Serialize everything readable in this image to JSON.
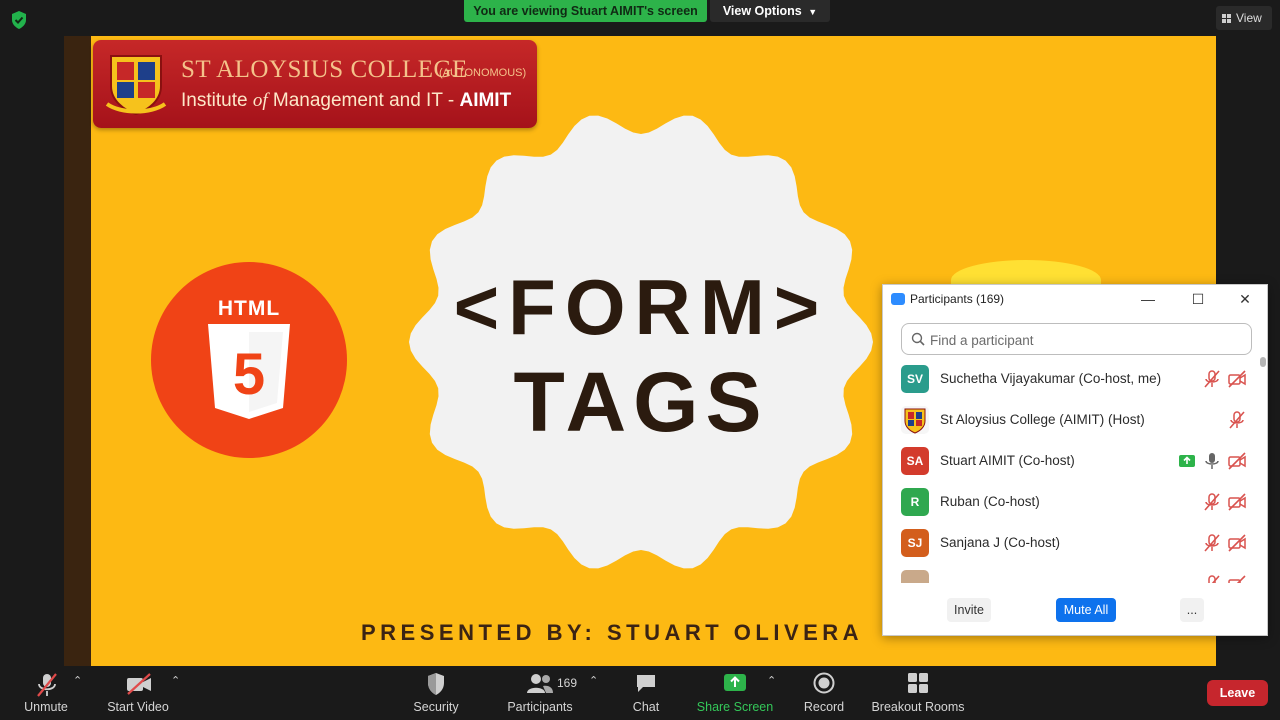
{
  "colors": {
    "accent_green": "#2db34a",
    "slide_bg": "#fdb913",
    "mute_all": "#0e72ed",
    "leave": "#c6262d"
  },
  "topbar": {
    "viewing_text": "You are viewing Stuart AIMIT's screen",
    "view_options": "View Options",
    "view_label": "View"
  },
  "slide": {
    "college_name": "ST ALOYSIUS COLLEGE",
    "college_autonomous": "(AUTONOMOUS)",
    "college_sub_prefix": "Institute ",
    "college_sub_of": "of",
    "college_sub_rest": " Management and IT - ",
    "college_sub_brand": "AIMIT",
    "html5_label": "HTML",
    "html5_number": "5",
    "title_line1": "<FORM>",
    "title_line2": "TAGS",
    "presented_by": "PRESENTED BY: STUART OLIVERA"
  },
  "participants_panel": {
    "title": "Participants (169)",
    "search_placeholder": "Find a participant",
    "participants": [
      {
        "initials": "SV",
        "name": "Suchetha Vijayakumar (Co-host, me)",
        "color": "#2a9c8c"
      },
      {
        "initials": "",
        "name": "St Aloysius College (AIMIT) (Host)",
        "color": "#b71c1c"
      },
      {
        "initials": "SA",
        "name": "Stuart AIMIT (Co-host)",
        "color": "#d33b2c"
      },
      {
        "initials": "R",
        "name": "Ruban (Co-host)",
        "color": "#2fa84f"
      },
      {
        "initials": "SJ",
        "name": "Sanjana J (Co-host)",
        "color": "#d35e1c"
      }
    ],
    "invite": "Invite",
    "mute_all": "Mute All",
    "more": "..."
  },
  "toolbar": {
    "unmute": "Unmute",
    "start_video": "Start Video",
    "security": "Security",
    "participants": "Participants",
    "participant_count": "169",
    "chat": "Chat",
    "share_screen": "Share Screen",
    "record": "Record",
    "breakout_rooms": "Breakout Rooms",
    "leave": "Leave"
  }
}
